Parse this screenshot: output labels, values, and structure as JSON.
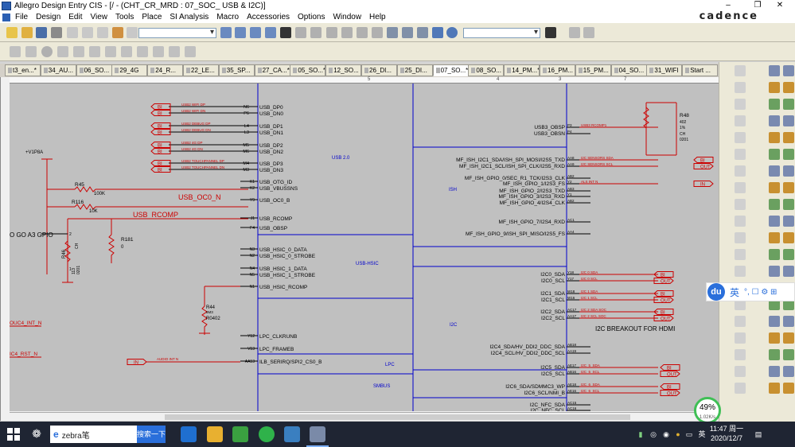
{
  "window": {
    "title": "Allegro Design Entry CIS - [/ - (CHT_CR_MRD : 07_SOC_ USB & I2C)]",
    "minimize": "–",
    "maximize": "❐",
    "close": "✕"
  },
  "menu": {
    "items": [
      "File",
      "Design",
      "Edit",
      "View",
      "Tools",
      "Place",
      "SI Analysis",
      "Macro",
      "Accessories",
      "Options",
      "Window",
      "Help"
    ],
    "brand": "cadence"
  },
  "tabs": [
    {
      "label": "t3_en...*"
    },
    {
      "label": "34_AU..."
    },
    {
      "label": "06_SO..."
    },
    {
      "label": "29_4G"
    },
    {
      "label": "24_R..."
    },
    {
      "label": "22_LE..."
    },
    {
      "label": "35_SP..."
    },
    {
      "label": "27_CA...*"
    },
    {
      "label": "05_SO...*"
    },
    {
      "label": "12_SO..."
    },
    {
      "label": "26_DI..."
    },
    {
      "label": "25_DI..."
    },
    {
      "label": "07_SO...*",
      "active": true
    },
    {
      "label": "08_SO..."
    },
    {
      "label": "14_PM...*"
    },
    {
      "label": "16_PM..."
    },
    {
      "label": "15_PM..."
    },
    {
      "label": "04_SO..."
    },
    {
      "label": "31_WIFI"
    },
    {
      "label": "Start ..."
    }
  ],
  "ruler": {
    "marks": [
      "5",
      "4",
      "3",
      "7"
    ]
  },
  "schematic": {
    "usb_pins_left": [
      {
        "pin": "N6",
        "name": "USB_DP0",
        "net": "USB2 WIFI DP"
      },
      {
        "pin": "P6",
        "name": "USB_DN0",
        "net": "USB2 WIFI DN"
      },
      {
        "pin": "L4",
        "name": "USB_DP1",
        "net": "USB2 DEBUG DP"
      },
      {
        "pin": "L3",
        "name": "USB_DN1",
        "net": "USB2 DEBUG DN"
      },
      {
        "pin": "M5",
        "name": "USB_DP2",
        "net": "USB2 4G DP"
      },
      {
        "pin": "M6",
        "name": "USB_DN2",
        "net": "USB2 4G DN"
      },
      {
        "pin": "M4",
        "name": "USB_DP3",
        "net": "USB2 TOUCHPANNEL DP"
      },
      {
        "pin": "M3",
        "name": "USB_DN3",
        "net": "USB2 TOUCHPANNEL DN"
      }
    ],
    "usb_other_pins": [
      {
        "pin": "K1",
        "name": "USB_OTG_ID"
      },
      {
        "pin": "K2",
        "name": "USB_VBUSSNS"
      },
      {
        "pin": "Y9",
        "name": "USB_OC0_B"
      },
      {
        "pin": "J1",
        "name": "USB_RCOMP"
      },
      {
        "pin": "F4",
        "name": "USB_OBSP"
      },
      {
        "pin": "N3",
        "name": "USB_HSIC_0_DATA"
      },
      {
        "pin": "N2",
        "name": "USB_HSIC_0_STROBE"
      },
      {
        "pin": "N4",
        "name": "USB_HSIC_1_DATA"
      },
      {
        "pin": "N5",
        "name": "USB_HSIC_1_STROBE"
      },
      {
        "pin": "N1",
        "name": "USB_HSIC_RCOMP"
      },
      {
        "pin": "Y12",
        "name": "LPC_CLKRUNB"
      },
      {
        "pin": "V13",
        "name": "LPC_FRAMEB"
      },
      {
        "pin": "AA13",
        "name": "ILB_SERIRQ/SPI2_CS0_B"
      }
    ],
    "left_parts": {
      "power": "+V1P8A",
      "r45": "R45",
      "r45_val": "100K",
      "r116": "R116",
      "r116_val": "10K",
      "net_oc": "USB_OC0_N",
      "net_rcomp": "USB_RCOMP",
      "r181": "R181",
      "r181_val": "0",
      "r46": "R46",
      "r46_a": "113",
      "r46_b": "0201",
      "r46_pin1": "1",
      "r46_pin2": "2",
      "ch": "CH",
      "r44": "R44",
      "r44_a": "6M3",
      "r44_b": "R0402",
      "go_label": "O GO A3 GPIO",
      "net_int": "OUC4_INT_N",
      "net_rst": "IC4_RST_N",
      "audio_net": "AUDIO INT N",
      "in_label": "IN"
    },
    "blocks": [
      "USB 2.0",
      "USB-HSIC",
      "I2C",
      "LPC",
      "SMBUS",
      "ISH"
    ],
    "right_pins": [
      {
        "pin": "P3",
        "name": "USB3_OBSP",
        "net": "USB3 RCOMP1"
      },
      {
        "pin": "P4",
        "name": "USB3_OBSN",
        "net": ""
      },
      {
        "pin": "AA8",
        "name": "MF_ISH_I2C1_SDA/ISH_SPI_MOSI/I2S5_TXD",
        "net": "I2C SENSORS SDA"
      },
      {
        "pin": "AA9",
        "name": "MF_ISH_I2C1_SCL/ISH_SPI_CLK/I2S5_RXD",
        "net": "I2C SENSORS SCL"
      },
      {
        "pin": "AB2",
        "name": "MF_ISH_GPIO_0/SEC_R1_TCK/I2S3_CLK",
        "net": ""
      },
      {
        "pin": "Y2",
        "name": "MF_ISH_GPIO_1/I2S3_FS",
        "net": "ALS INT N"
      },
      {
        "pin": "AB3",
        "name": "MF_ISH_GPIO_2/I2S3_TXD",
        "net": ""
      },
      {
        "pin": "Y1",
        "name": "MF_ISH_GPIO_3/I2S3_RXD",
        "net": ""
      },
      {
        "pin": "AB2",
        "name": "MF_ISH_GPIO_4/I2S4_CLK",
        "net": ""
      },
      {
        "pin": "AC1",
        "name": "MF_ISH_GPIO_7/I2S4_RXD",
        "net": ""
      },
      {
        "pin": "AA4",
        "name": "MF_ISH_GPIO_9/ISH_SPI_MISO/I2S5_FS",
        "net": ""
      },
      {
        "pin": "Y18",
        "name": "I2C0_SDA",
        "net": "I2C 0 SDA"
      },
      {
        "pin": "Y17",
        "name": "I2C0_SCL",
        "net": "I2C 0 SCL"
      },
      {
        "pin": "W18",
        "name": "I2C1_SDA",
        "net": "I2C 1 SDA"
      },
      {
        "pin": "W16",
        "name": "I2C1_SCL",
        "net": "I2C 1 SCL"
      },
      {
        "pin": "AC17",
        "name": "I2C2_SDA",
        "net": "I2C 2 SDA SOC"
      },
      {
        "pin": "AA17",
        "name": "I2C2_SCL",
        "net": "I2C 2 SCL SOC"
      },
      {
        "pin": "AB18",
        "name": "I2C4_SDA/HV_DDI2_DDC_SDA",
        "net": ""
      },
      {
        "pin": "AA19",
        "name": "I2C4_SCL/HV_DDI2_DDC_SCL",
        "net": ""
      },
      {
        "pin": "AE17",
        "name": "I2C5_SDA",
        "net": "I2C_5_SDA"
      },
      {
        "pin": "AB16",
        "name": "I2C5_SCL",
        "net": "I2C_5_SCL"
      },
      {
        "pin": "AE18",
        "name": "I2C6_SDA/SDMMC3_WP",
        "net": "I2C_6_SDA"
      },
      {
        "pin": "AE16",
        "name": "I2C6_SCL/NMI_B",
        "net": "I2C_6_SCL"
      },
      {
        "pin": "AC15",
        "name": "I2C_NFC_SDA",
        "net": ""
      },
      {
        "pin": "AC16",
        "name": "I2C_NFC_SCL",
        "net": ""
      }
    ],
    "r48": {
      "ref": "R48",
      "val1": "402",
      "val2": "1%",
      "val3": "CH",
      "val4": "0201"
    },
    "hdmi_label": "I2C BREAKOUT FOR HDMI",
    "port_bi": "BI",
    "port_out": "OUT",
    "port_in": "IN"
  },
  "ime": {
    "logo": "du",
    "lang": "英",
    "icons": "°, ☐ ⚙ ⊞"
  },
  "net_widget": {
    "percent": "49%",
    "rate": "1.02K/s"
  },
  "taskbar": {
    "search_text": "zebra笔",
    "search_button": "搜索一下",
    "clock_time": "11:47 周一",
    "clock_date": "2020/12/7",
    "ime_lang": "英"
  },
  "colors": {
    "sheet_bg": "#c0c0c0",
    "wire_blue": "#0000cc",
    "net_red": "#cc0000",
    "pin_text": "#000000"
  }
}
